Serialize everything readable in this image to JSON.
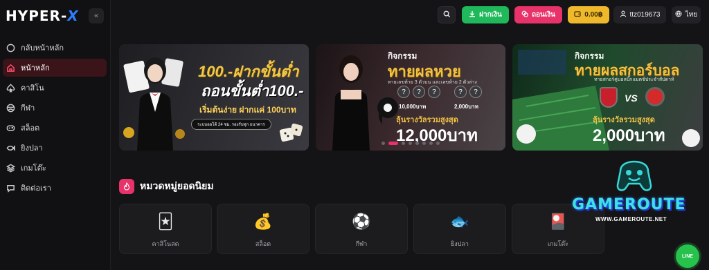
{
  "brand": {
    "name_left": "HYPER-",
    "name_x": "X"
  },
  "sidebar": {
    "collapse_icon": "«",
    "items": [
      {
        "label": "กลับหน้าหลัก",
        "icon": "circle-icon",
        "active": false
      },
      {
        "label": "หน้าหลัก",
        "icon": "home-icon",
        "active": true
      },
      {
        "label": "คาสิโน",
        "icon": "spade-icon",
        "active": false
      },
      {
        "label": "กีฬา",
        "icon": "ball-icon",
        "active": false
      },
      {
        "label": "สล็อต",
        "icon": "gamepad-icon",
        "active": false
      },
      {
        "label": "ยิงปลา",
        "icon": "fish-icon",
        "active": false
      },
      {
        "label": "เกมโต๊ะ",
        "icon": "layers-icon",
        "active": false
      },
      {
        "label": "ติดต่อเรา",
        "icon": "chat-icon",
        "active": false
      }
    ]
  },
  "topbar": {
    "deposit_label": "ฝากเงิน",
    "withdraw_label": "ถอนเงิน",
    "balance": "0.00฿",
    "username": "ttz019673",
    "language": "ไทย"
  },
  "banners": [
    {
      "line1": "100.-ฝากขั้นต่ำ",
      "line2": "ถอนขั้นต่ำ100.-",
      "line3": "เริ่มต้นง่าย ฝากแค่ 100บาท",
      "pill": "ระบบออโต้ 24 ชม. รองรับทุก ธนาคาร"
    },
    {
      "kicker": "กิจกรรม",
      "title": "ทายผลหวย",
      "subtitle": "ทายเลขท้าย 3 ตัวบน และเลขท้าย 2 ตัวล่าง",
      "prize_a": "10,000บาท",
      "prize_b": "2,000บาท",
      "total_label": "ลุ้นรางวัลรวมสูงสุด",
      "total_value": "12,000บาท"
    },
    {
      "kicker": "กิจกรรม",
      "title": "ทายผลสกอร์บอล",
      "subtitle": "ทายสกอร์คู่บอลบิ๊กแมตช์ประจำสัปดาห์",
      "vs": "VS",
      "total_label": "ลุ้นรางวัลรวมสูงสุด",
      "total_value": "2,000บาท"
    }
  ],
  "carousel": {
    "count": 8,
    "active_index": 1
  },
  "categories": {
    "title": "หมวดหมู่ยอดนิยม",
    "items": [
      {
        "label": "คาสิโนสด",
        "icon": "casino-chips-icon"
      },
      {
        "label": "สล็อต",
        "icon": "treasure-chest-icon"
      },
      {
        "label": "กีฬา",
        "icon": "soccer-ball-icon"
      },
      {
        "label": "ยิงปลา",
        "icon": "fish-icon"
      },
      {
        "label": "เกมโต๊ะ",
        "icon": "cards-icon"
      }
    ]
  },
  "watermark": {
    "name": "GAMEROUTE",
    "url": "WWW.GAMEROUTE.NET"
  },
  "line_chat": {
    "label": "LINE"
  }
}
